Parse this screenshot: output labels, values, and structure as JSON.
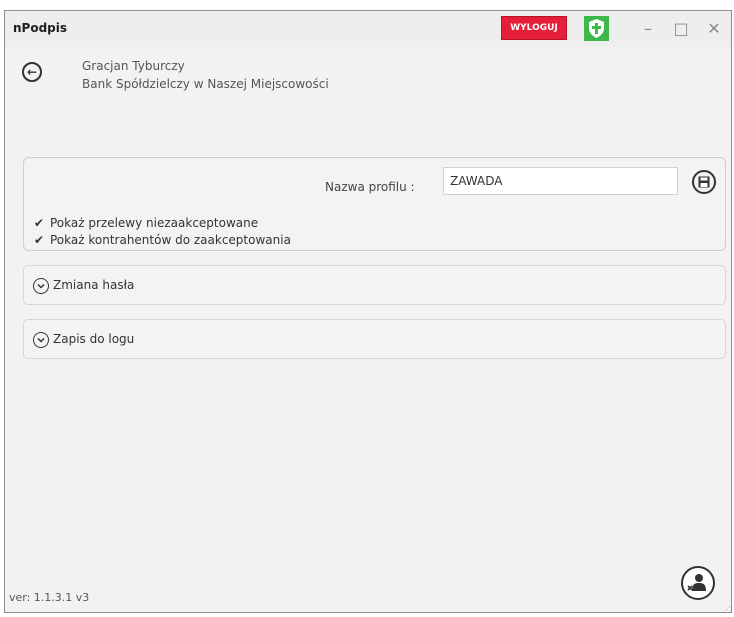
{
  "app": {
    "title": "nPodpis",
    "logout_label": "WYLOGUJ",
    "shield_icon": "shield-check-icon",
    "minimize_glyph": "–",
    "maximize_glyph": "□",
    "close_glyph": "✕"
  },
  "header": {
    "user_name": "Gracjan Tyburczy",
    "bank_name": "Bank Spółdzielczy w Naszej Miejscowości"
  },
  "profile": {
    "label": "Nazwa profilu :",
    "value": "ZAWADA",
    "options": [
      {
        "label": "Pokaż przelewy niezaakceptowane",
        "checked": true
      },
      {
        "label": "Pokaż kontrahentów do zaakceptowania",
        "checked": true
      }
    ]
  },
  "sections": [
    {
      "label": "Zmiana hasła"
    },
    {
      "label": "Zapis do logu"
    }
  ],
  "footer": {
    "version": "ver: 1.1.3.1  v3"
  },
  "colors": {
    "logout_bg": "#e51e39",
    "shield_green": "#3fb84a"
  }
}
